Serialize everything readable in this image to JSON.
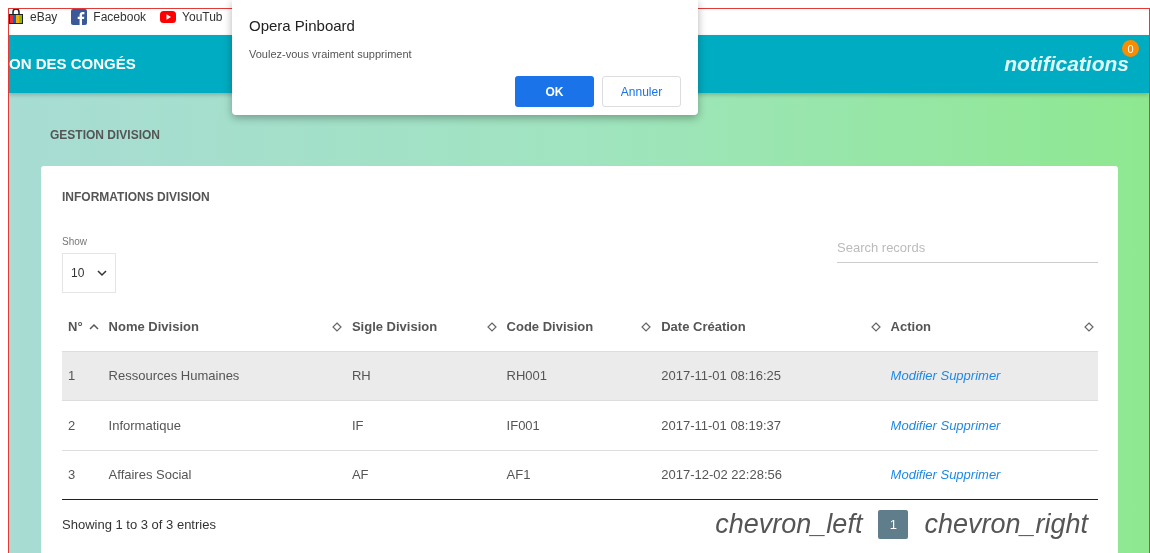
{
  "bookmarks": [
    {
      "label": "eBay",
      "kind": "ebay"
    },
    {
      "label": "Facebook",
      "kind": "facebook"
    },
    {
      "label": "YouTub",
      "kind": "youtube"
    }
  ],
  "header": {
    "title": "ON DES CONGÉS",
    "notifications": "notifications",
    "badge": "0"
  },
  "dialog": {
    "title": "Opera Pinboard",
    "message": "Voulez-vous vraiment suppriment",
    "buttons": [
      {
        "label": "OK",
        "kind": "primary"
      },
      {
        "label": "Annuler",
        "kind": "secondary"
      }
    ]
  },
  "page_title": "GESTION DIVISION",
  "card": {
    "title": "INFORMATIONS DIVISION",
    "show_label": "Show",
    "page_size": "10",
    "search": {
      "placeholder": "Search records"
    },
    "columns": [
      {
        "label": "N°",
        "sorted": true
      },
      {
        "label": "Nome Division",
        "sorted": false
      },
      {
        "label": "Sigle Division",
        "sorted": false
      },
      {
        "label": "Code Division",
        "sorted": false
      },
      {
        "label": "Date Création",
        "sorted": false
      },
      {
        "label": "Action",
        "sorted": false
      }
    ],
    "rows": [
      {
        "selected": true,
        "cells": [
          "1",
          "Ressources Humaines",
          "RH",
          "RH001",
          "2017-11-01 08:16:25"
        ],
        "actions": [
          "Modifier",
          "Supprimer"
        ]
      },
      {
        "selected": false,
        "cells": [
          "2",
          "Informatique",
          "IF",
          "IF001",
          "2017-11-01 08:19:37"
        ],
        "actions": [
          "Modifier",
          "Supprimer"
        ]
      },
      {
        "selected": false,
        "cells": [
          "3",
          "Affaires Social",
          "AF",
          "AF1",
          "2017-12-02 22:28:56"
        ],
        "actions": [
          "Modifier",
          "Supprimer"
        ]
      }
    ],
    "summary": "Showing 1 to 3 of 3 entries",
    "pagination": {
      "prev": "chevron_left",
      "pages": [
        {
          "label": "1",
          "selected": true
        }
      ],
      "next": "chevron_right"
    }
  }
}
